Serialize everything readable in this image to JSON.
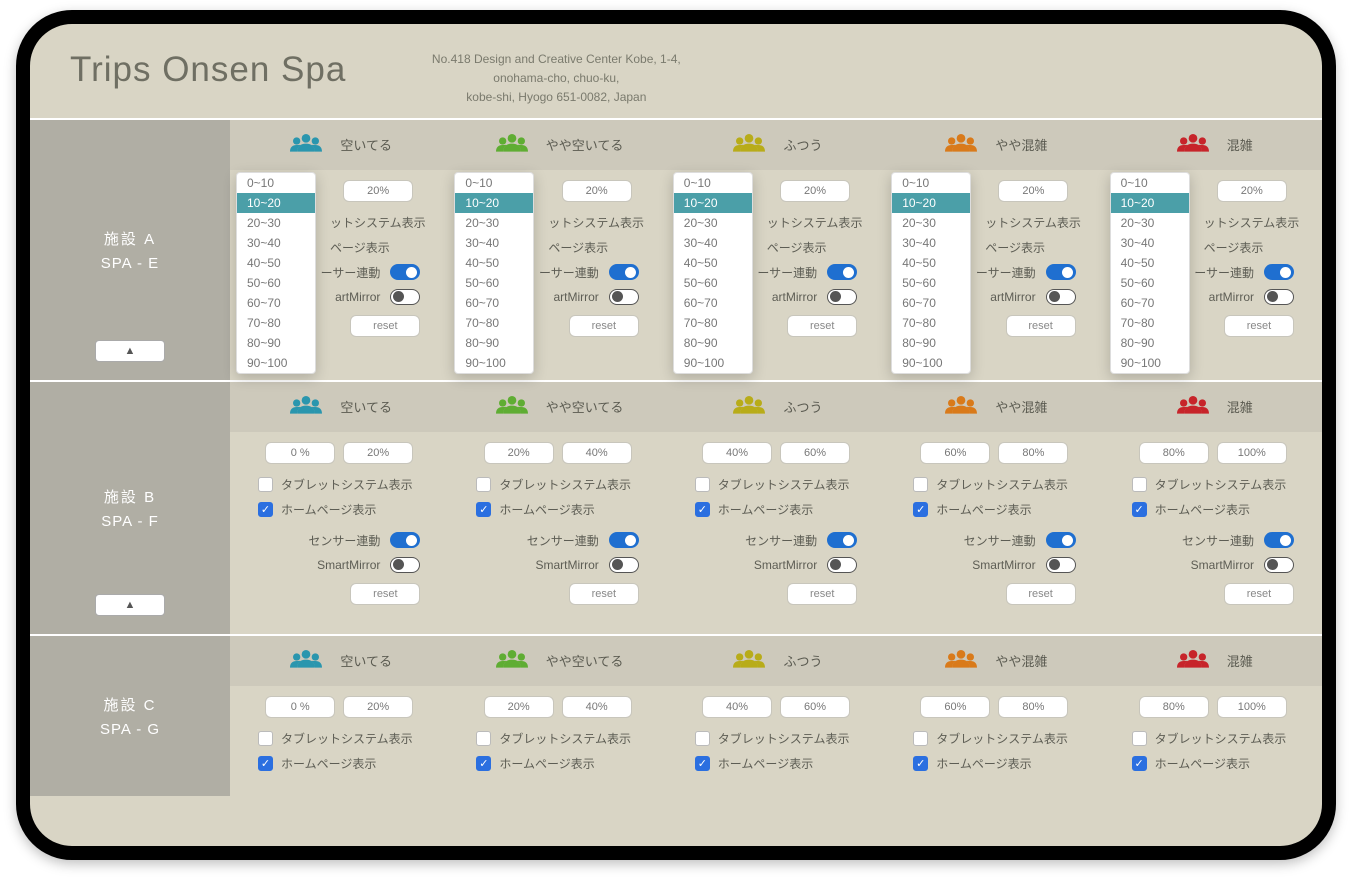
{
  "header": {
    "title": "Trips Onsen Spa",
    "address_line1": "No.418 Design and Creative Center Kobe, 1-4,",
    "address_line2": "onohama-cho, chuo-ku,",
    "address_line3": "kobe-shi, Hyogo 651-0082, Japan"
  },
  "statuses": [
    {
      "label": "空いてる",
      "color": "#2a96ae"
    },
    {
      "label": "やや空いてる",
      "color": "#5fad33"
    },
    {
      "label": "ふつう",
      "color": "#b8ac19"
    },
    {
      "label": "やや混雑",
      "color": "#d97a1a"
    },
    {
      "label": "混雑",
      "color": "#c7242a"
    }
  ],
  "dropdown_options": [
    "0~10",
    "10~20",
    "20~30",
    "30~40",
    "40~50",
    "50~60",
    "60~70",
    "70~80",
    "80~90",
    "90~100"
  ],
  "dropdown_selected": "10~20",
  "labels": {
    "tablet_display": "タブレットシステム表示",
    "homepage_display": "ホームページ表示",
    "sensor_link": "センサー連動",
    "smart_mirror": "SmartMirror",
    "reset": "reset",
    "collapse": "▲"
  },
  "facilities": [
    {
      "name_jp": "施設 A",
      "name_en": "SPA - E",
      "show_dropdowns": true,
      "show_collapse": true,
      "cells": [
        {
          "p1": "",
          "p2": "20%",
          "tablet": false,
          "home": false,
          "sensor": true,
          "mirror": false,
          "reset": true,
          "hide_p1": true
        },
        {
          "p1": "",
          "p2": "20%",
          "tablet": false,
          "home": false,
          "sensor": true,
          "mirror": false,
          "reset": true,
          "hide_p1": true
        },
        {
          "p1": "",
          "p2": "20%",
          "tablet": false,
          "home": false,
          "sensor": true,
          "mirror": false,
          "reset": true,
          "hide_p1": true
        },
        {
          "p1": "",
          "p2": "20%",
          "tablet": false,
          "home": false,
          "sensor": true,
          "mirror": false,
          "reset": true,
          "hide_p1": true
        },
        {
          "p1": "",
          "p2": "20%",
          "tablet": false,
          "home": false,
          "sensor": true,
          "mirror": false,
          "reset": true,
          "hide_p1": true
        }
      ]
    },
    {
      "name_jp": "施設 B",
      "name_en": "SPA - F",
      "show_dropdowns": false,
      "show_collapse": true,
      "cells": [
        {
          "p1": "0 %",
          "p2": "20%",
          "tablet": false,
          "home": true,
          "sensor": true,
          "mirror": false,
          "reset": true
        },
        {
          "p1": "20%",
          "p2": "40%",
          "tablet": false,
          "home": true,
          "sensor": true,
          "mirror": false,
          "reset": true
        },
        {
          "p1": "40%",
          "p2": "60%",
          "tablet": false,
          "home": true,
          "sensor": true,
          "mirror": false,
          "reset": true
        },
        {
          "p1": "60%",
          "p2": "80%",
          "tablet": false,
          "home": true,
          "sensor": true,
          "mirror": false,
          "reset": true
        },
        {
          "p1": "80%",
          "p2": "100%",
          "tablet": false,
          "home": true,
          "sensor": true,
          "mirror": false,
          "reset": true
        }
      ]
    },
    {
      "name_jp": "施設 C",
      "name_en": "SPA - G",
      "show_dropdowns": false,
      "show_collapse": false,
      "truncated": true,
      "cells": [
        {
          "p1": "0 %",
          "p2": "20%",
          "tablet": false,
          "home": true
        },
        {
          "p1": "20%",
          "p2": "40%",
          "tablet": false,
          "home": true
        },
        {
          "p1": "40%",
          "p2": "60%",
          "tablet": false,
          "home": true
        },
        {
          "p1": "60%",
          "p2": "80%",
          "tablet": false,
          "home": true
        },
        {
          "p1": "80%",
          "p2": "100%",
          "tablet": false,
          "home": true
        }
      ]
    }
  ]
}
